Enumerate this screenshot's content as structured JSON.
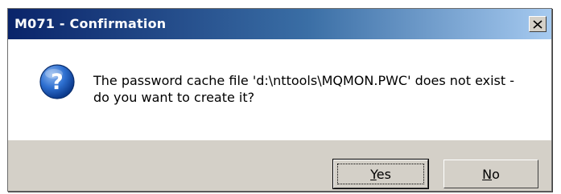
{
  "dialog": {
    "title": "M071 - Confirmation",
    "close_icon": "close-icon",
    "icon": "question-icon",
    "message_line1": "The password cache file 'd:\\nttools\\MQMON.PWC' does not exist -",
    "message_line2": "do you want to create it?",
    "buttons": {
      "yes_mnemonic": "Y",
      "yes_rest": "es",
      "no_mnemonic": "N",
      "no_rest": "o"
    }
  },
  "colors": {
    "title_start": "#0a246a",
    "title_end": "#a6caf0",
    "face": "#d4d0c8",
    "icon_blue": "#1f5fbf"
  }
}
